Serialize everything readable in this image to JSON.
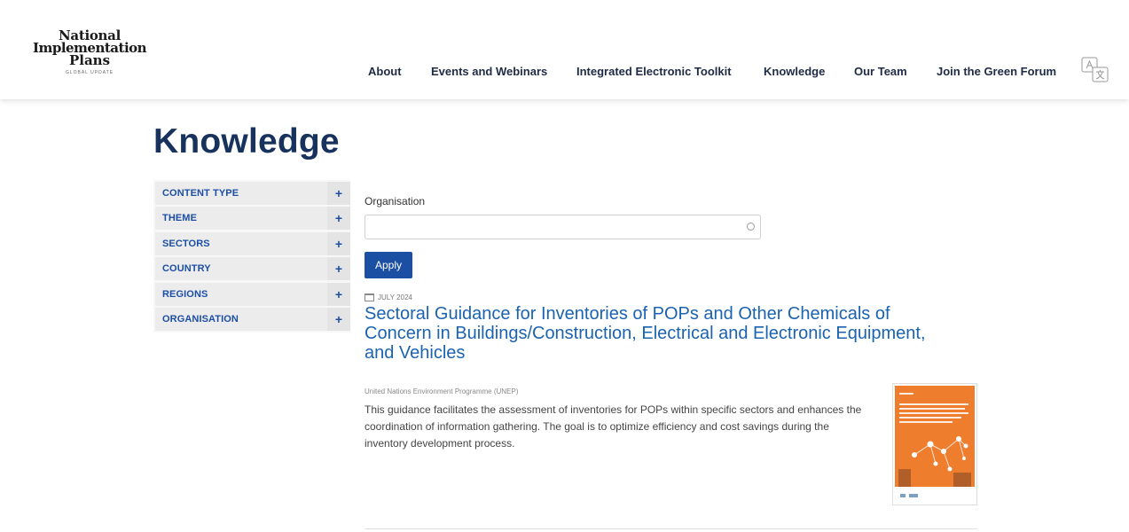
{
  "logo": {
    "line1": "National",
    "line2": "Implementation",
    "line3": "Plans",
    "tagline": "GLOBAL UPDATE"
  },
  "nav": {
    "items": [
      {
        "label": "About"
      },
      {
        "label": "Events and Webinars"
      },
      {
        "label": "Integrated Electronic Toolkit"
      },
      {
        "label": "Knowledge"
      },
      {
        "label": "Our Team"
      },
      {
        "label": "Join the Green Forum"
      }
    ],
    "translate_icon": "translate-icon"
  },
  "page": {
    "title": "Knowledge"
  },
  "filters": {
    "items": [
      {
        "label": "CONTENT TYPE",
        "expand_symbol": "+"
      },
      {
        "label": "THEME",
        "expand_symbol": "+"
      },
      {
        "label": "SECTORS",
        "expand_symbol": "+"
      },
      {
        "label": "COUNTRY",
        "expand_symbol": "+"
      },
      {
        "label": "REGIONS",
        "expand_symbol": "+"
      },
      {
        "label": "ORGANISATION",
        "expand_symbol": "+"
      }
    ]
  },
  "organisation_filter": {
    "label": "Organisation",
    "value": "",
    "apply_label": "Apply"
  },
  "result": {
    "date": "JULY 2024",
    "title": "Sectoral Guidance for Inventories of POPs and Other Chemicals of Concern in Buildings/Construction, Electrical and Electronic Equipment, and Vehicles",
    "source": "United Nations Environment Programme (UNEP)",
    "description": "This guidance facilitates the assessment of inventories for POPs within specific sectors and enhances the coordination of information gathering. The goal is to optimize efficiency and cost savings during the inventory development process."
  },
  "colors": {
    "brand_dark": "#17325c",
    "link_blue": "#1b63b0",
    "button_blue": "#1b4fa4",
    "cover_orange": "#ef7d2e"
  }
}
